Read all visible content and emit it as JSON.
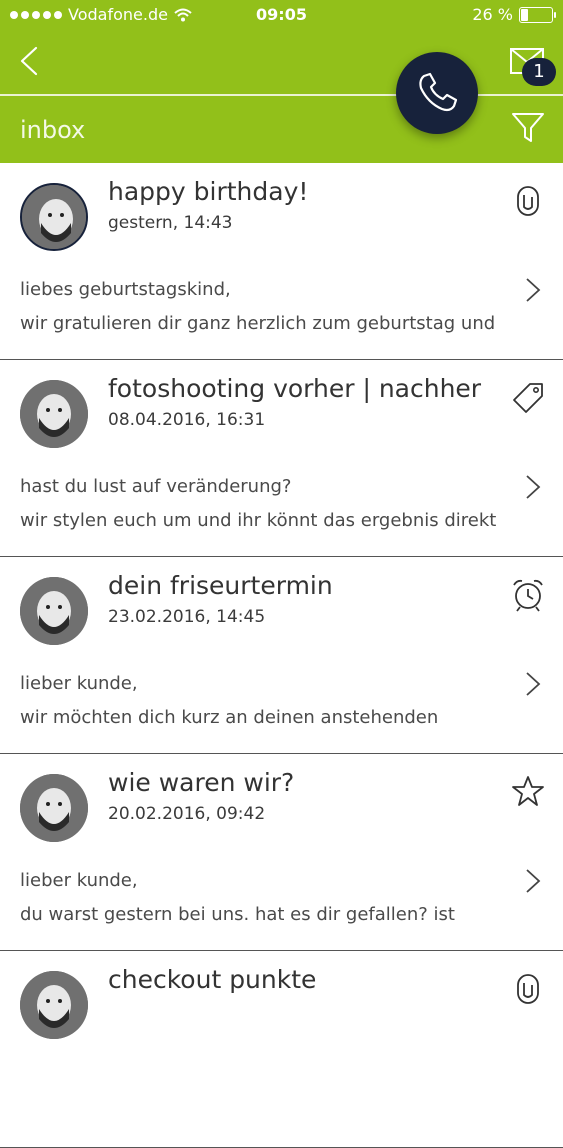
{
  "status_bar": {
    "carrier": "Vodafone.de",
    "time": "09:05",
    "battery": "26 %"
  },
  "header": {
    "title": "inbox",
    "mail_badge": "1"
  },
  "messages": [
    {
      "title": "happy birthday!",
      "date": "gestern, 14:43",
      "preview_line1": "liebes geburtstagskind,",
      "preview_line2": "wir gratulieren dir ganz herzlich zum geburtstag und",
      "icon": "paperclip-icon"
    },
    {
      "title": "fotoshooting vorher | nachher",
      "date": "08.04.2016, 16:31",
      "preview_line1": "hast du lust auf veränderung?",
      "preview_line2": "wir stylen euch um und ihr könnt das ergebnis direkt",
      "icon": "tag-icon"
    },
    {
      "title": "dein friseurtermin",
      "date": "23.02.2016, 14:45",
      "preview_line1": "lieber kunde,",
      "preview_line2": "wir möchten dich kurz an deinen anstehenden",
      "icon": "alarm-clock-icon"
    },
    {
      "title": "wie waren wir?",
      "date": "20.02.2016, 09:42",
      "preview_line1": "lieber kunde,",
      "preview_line2": "du warst gestern bei uns. hat es dir gefallen? ist",
      "icon": "star-icon"
    },
    {
      "title": "checkout punkte",
      "date": "",
      "preview_line1": "",
      "preview_line2": "",
      "icon": "paperclip-icon"
    }
  ],
  "colors": {
    "header_green": "#92c01a",
    "accent_navy": "#17223b"
  }
}
